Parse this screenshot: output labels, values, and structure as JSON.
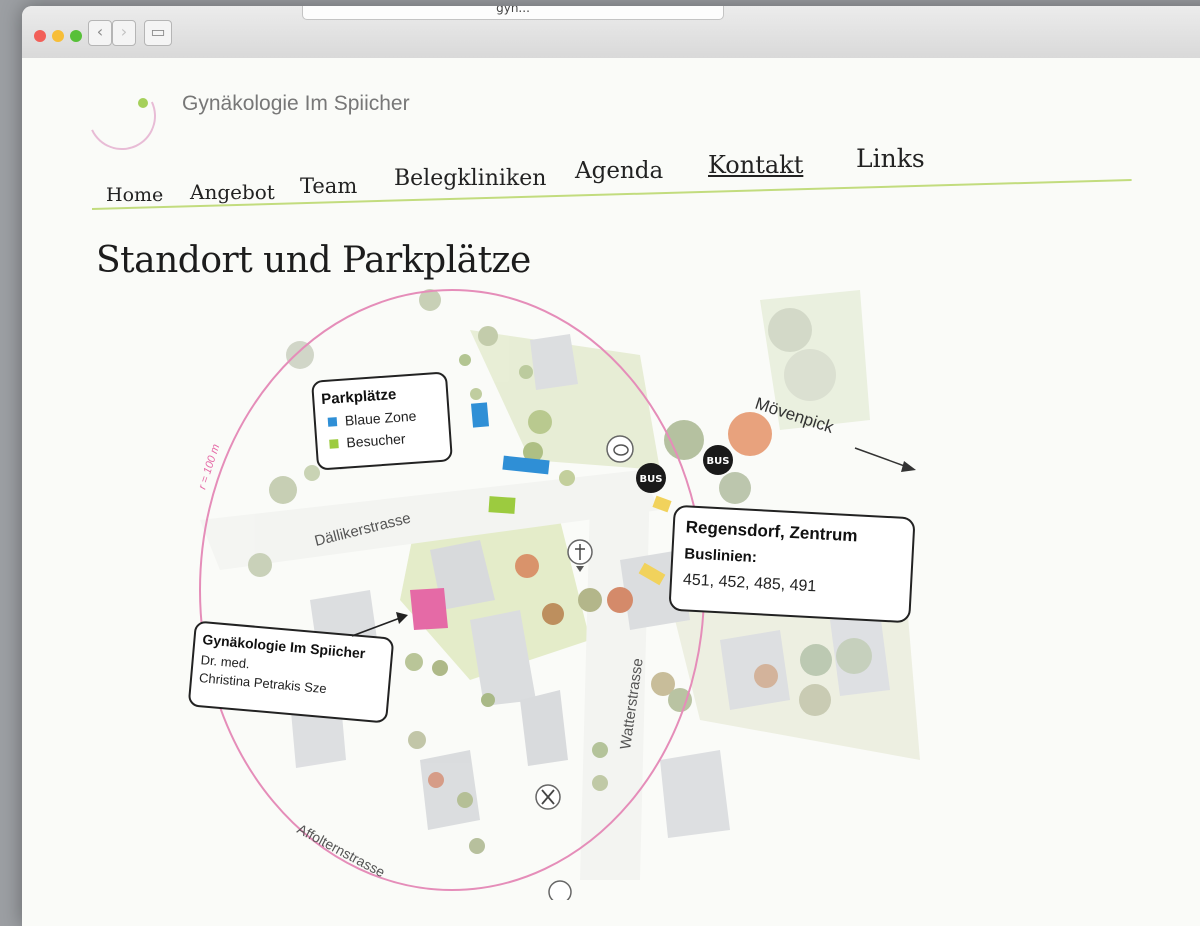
{
  "browser": {
    "url_text": "gyn...",
    "back_icon": "chevron-left-icon",
    "forward_icon": "chevron-right-icon",
    "sidebar_icon": "sidebar-icon"
  },
  "site": {
    "brand": "Gynäkologie Im Spiicher",
    "accent_color": "#a5d05a",
    "brand_color": "#e56aa6"
  },
  "nav": {
    "items": [
      {
        "label": "Home"
      },
      {
        "label": "Angebot"
      },
      {
        "label": "Team"
      },
      {
        "label": "Belegkliniken"
      },
      {
        "label": "Agenda"
      },
      {
        "label": "Kontakt",
        "active": true
      },
      {
        "label": "Links"
      }
    ]
  },
  "page": {
    "title": "Standort und Parkplätze"
  },
  "map": {
    "radius_label": "r = 100 m",
    "streets": {
      "dallikerstrasse": "Dällikerstrasse",
      "watterstrasse": "Watterstrasse",
      "affolternstrasse": "Affolternstrasse",
      "movenpick": "Mövenpick"
    },
    "parking_box": {
      "title": "Parkplätze",
      "legend": [
        {
          "label": "Blaue Zone",
          "color": "#2f8fd6"
        },
        {
          "label": "Besucher",
          "color": "#9ccb3f"
        }
      ]
    },
    "practice_box": {
      "name": "Gynäkologie Im Spiicher",
      "line1": "Dr. med.",
      "line2": "Christina Petrakis Sze"
    },
    "bus_box": {
      "stop": "Regensdorf, Zentrum",
      "lines_label": "Buslinien:",
      "lines": "451, 452, 485, 491"
    },
    "bus_badge": "BUS",
    "icons": [
      "piggy-bank-icon",
      "church-icon",
      "restaurant-icon",
      "bus-stop-icon"
    ]
  }
}
